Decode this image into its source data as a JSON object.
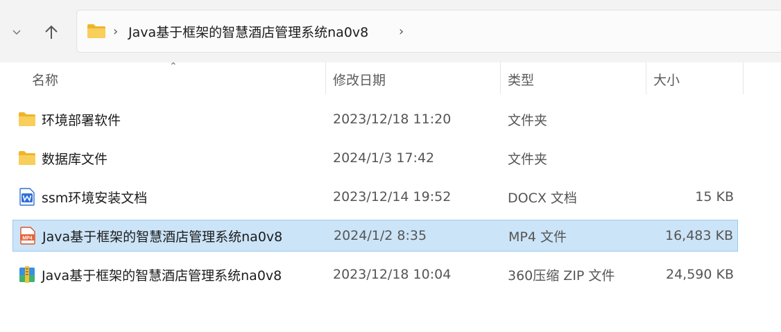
{
  "address_bar": {
    "path_segment": "Java基于框架的智慧酒店管理系统na0v8",
    "separator": "›"
  },
  "nav": {
    "recent_chevron": "⌵",
    "up_arrow": "↑"
  },
  "columns": {
    "name": "名称",
    "date_modified": "修改日期",
    "type": "类型",
    "size": "大小"
  },
  "files": [
    {
      "name": "环境部署软件",
      "date": "2023/12/18 11:20",
      "type": "文件夹",
      "size": "",
      "icon": "folder-icon"
    },
    {
      "name": "数据库文件",
      "date": "2024/1/3 17:42",
      "type": "文件夹",
      "size": "",
      "icon": "folder-icon"
    },
    {
      "name": "ssm环境安装文档",
      "date": "2023/12/14 19:52",
      "type": "DOCX 文档",
      "size": "15 KB",
      "icon": "word-doc-icon"
    },
    {
      "name": "Java基于框架的智慧酒店管理系统na0v8",
      "date": "2024/1/2 8:35",
      "type": "MP4 文件",
      "size": "16,483 KB",
      "icon": "mp4-file-icon",
      "selected": true
    },
    {
      "name": "Java基于框架的智慧酒店管理系统na0v8",
      "date": "2023/12/18 10:04",
      "type": "360压缩 ZIP 文件",
      "size": "24,590 KB",
      "icon": "zip-archive-icon"
    }
  ],
  "colors": {
    "selection_bg": "#cce4f7",
    "selection_border": "#99c9ef",
    "folder": "#f5c242"
  }
}
